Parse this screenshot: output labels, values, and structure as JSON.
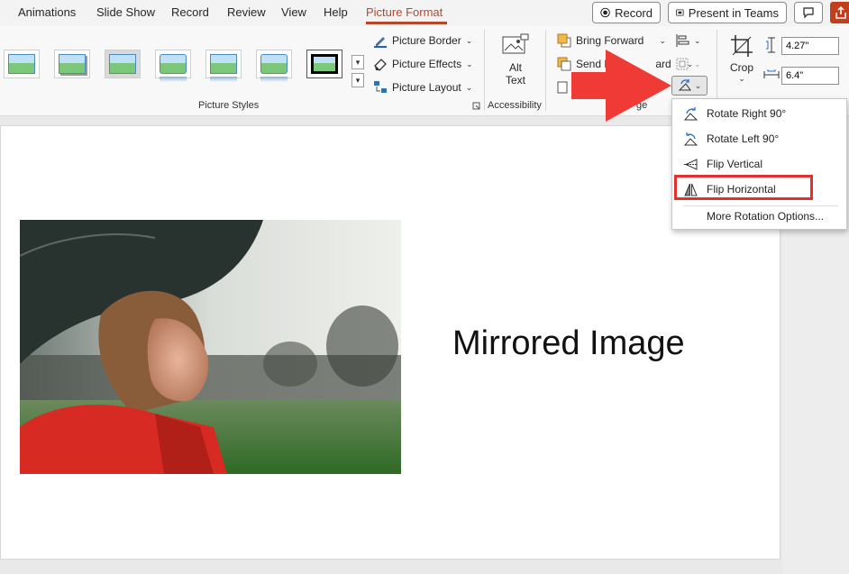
{
  "tabs": [
    "Animations",
    "Slide Show",
    "Record",
    "Review",
    "View",
    "Help",
    "Picture Format"
  ],
  "active_tab": "Picture Format",
  "top_buttons": {
    "record": "Record",
    "present_teams": "Present in Teams"
  },
  "ribbon": {
    "picture_styles": {
      "label": "Picture Styles",
      "border": "Picture Border",
      "effects": "Picture Effects",
      "layout": "Picture Layout"
    },
    "accessibility": {
      "label": "Accessibility",
      "alt_text_1": "Alt",
      "alt_text_2": "Text"
    },
    "arrange": {
      "label_tail": "ge",
      "bring_forward": "Bring Forward",
      "send_backward_head": "Send B",
      "send_backward_tail": "ard"
    },
    "size": {
      "crop": "Crop",
      "height": "4.27\"",
      "width": "6.4\""
    }
  },
  "rotate_menu": {
    "items": [
      {
        "label": "Rotate Right 90°",
        "icon": "rotate-right-icon"
      },
      {
        "label": "Rotate Left 90°",
        "icon": "rotate-left-icon"
      },
      {
        "label": "Flip Vertical",
        "icon": "flip-vertical-icon"
      },
      {
        "label": "Flip Horizontal",
        "icon": "flip-horizontal-icon"
      },
      {
        "label": "More Rotation Options...",
        "icon": ""
      }
    ]
  },
  "slide": {
    "title": "Mirrored Image"
  },
  "colors": {
    "accent": "#b7472a",
    "highlight": "#e2302c",
    "arrow": "#f03a36"
  }
}
